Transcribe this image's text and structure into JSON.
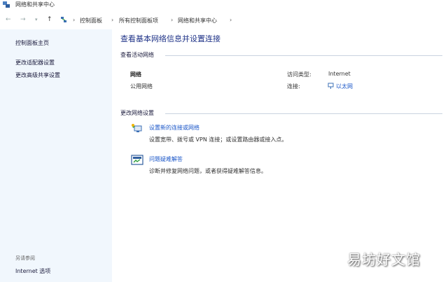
{
  "window": {
    "title": "网络和共享中心"
  },
  "nav": {
    "back_icon": "back-arrow-icon",
    "forward_icon": "forward-arrow-icon",
    "up_icon": "up-arrow-icon",
    "breadcrumbs": [
      "控制面板",
      "所有控制面板项",
      "网络和共享中心"
    ]
  },
  "sidebar": {
    "items": [
      {
        "label": "控制面板主页"
      },
      {
        "label": "更改适配器设置"
      },
      {
        "label": "更改高级共享设置"
      }
    ],
    "see_also": "另请参阅",
    "bottom_items": [
      {
        "label": "Internet 选项"
      }
    ]
  },
  "main": {
    "heading": "查看基本网络信息并设置连接",
    "active_networks_label": "查看活动网络",
    "network": {
      "name": "网络",
      "category": "公用网络",
      "access_type_label": "访问类型:",
      "access_type_value": "Internet",
      "connections_label": "连接:",
      "connections_value": "以太网"
    },
    "change_settings_label": "更改网络设置",
    "tasks": [
      {
        "title": "设置新的连接或网络",
        "description": "设置宽带、拨号或 VPN 连接；或设置路由器或接入点。",
        "icon": "new-connection-icon"
      },
      {
        "title": "问题疑难解答",
        "description": "诊断并修复网络问题，或者获得疑难解答信息。",
        "icon": "troubleshoot-icon"
      }
    ]
  },
  "watermark": "易坊好文馆",
  "colors": {
    "sidebar_bg": "#f1f7fd",
    "heading": "#1e3287",
    "link": "#1a56c8"
  }
}
